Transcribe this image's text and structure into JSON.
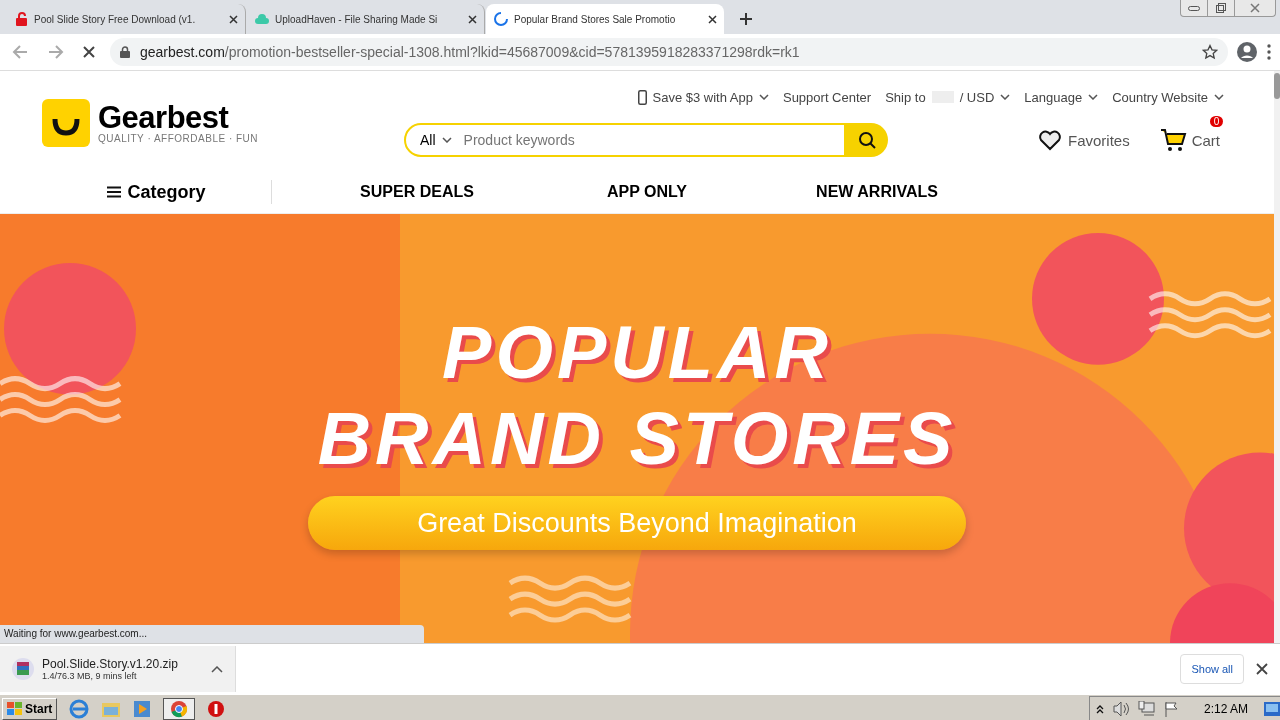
{
  "tabs": [
    {
      "title": "Pool Slide Story Free Download (v1.",
      "kind": "lock",
      "selected": false
    },
    {
      "title": "UploadHaven - File Sharing Made Si",
      "kind": "cloud",
      "selected": false
    },
    {
      "title": "Popular Brand Stores Sale Promotio",
      "kind": "loading",
      "selected": true
    }
  ],
  "address": {
    "host": "gearbest.com",
    "path": "/promotion-bestseller-special-1308.html?lkid=45687009&cid=5781395918283371298rdk=rk1"
  },
  "header": {
    "logo": "Gearbest",
    "tagline": "QUALITY · AFFORDABLE · FUN",
    "app_promo": "Save $3 with App",
    "support": "Support Center",
    "ship_to": "Ship to",
    "currency": "/ USD",
    "language": "Language",
    "country": "Country Website",
    "search_category": "All",
    "search_placeholder": "Product keywords",
    "favorites": "Favorites",
    "cart": "Cart",
    "cart_count": "0"
  },
  "nav": {
    "category": "Category",
    "items": [
      "SUPER DEALS",
      "APP ONLY",
      "NEW ARRIVALS"
    ]
  },
  "banner": {
    "title_lines": [
      "POPULAR",
      "BRAND STORES"
    ],
    "button": "Great Discounts Beyond Imagination"
  },
  "status_bubble": "Waiting for www.gearbest.com...",
  "download": {
    "filename": "Pool.Slide.Story.v1.20.zip",
    "progress": "1.4/76.3 MB, 9 mins left",
    "show_all": "Show all"
  },
  "taskbar": {
    "start": "Start",
    "clock": "2:12 AM"
  }
}
